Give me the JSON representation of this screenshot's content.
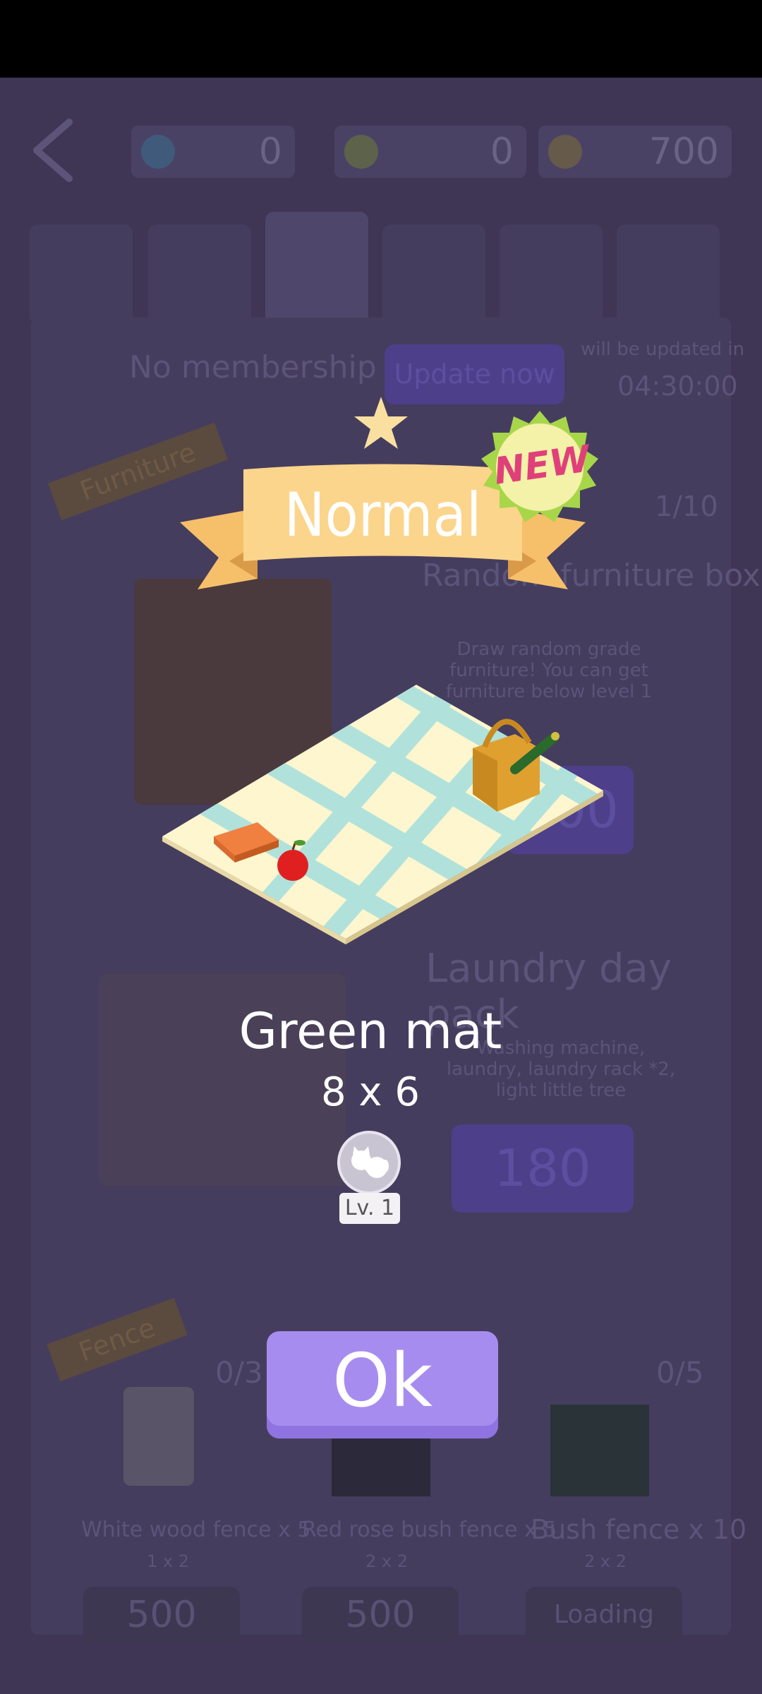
{
  "header": {
    "currency1_value": "0",
    "currency2_value": "0",
    "currency3_value": "700"
  },
  "background_shop": {
    "membership_text": "No membership",
    "update_button": "Update now",
    "update_info": "will be updated in",
    "timer": "04:30:00",
    "furniture_ribbon": "Furniture",
    "random_box_count": "1/10",
    "random_box_title": "Random furniture box",
    "random_box_desc": "Draw random grade furniture! You can get furniture below level 1",
    "random_box_price": "300",
    "laundry_title": "Laundry day pack",
    "laundry_desc": "Washing machine, laundry, laundry rack *2, light little tree",
    "laundry_price": "180",
    "fence_ribbon": "Fence",
    "fence_count_left": "0/3",
    "fence_count_right": "0/5",
    "fence1_name": "White wood fence x 5",
    "fence1_size": "1 x 2",
    "fence2_name": "Red rose bush fence x 5",
    "fence2_size": "2 x 2",
    "fence3_name": "Bush fence x 10",
    "fence3_size": "2 x 2",
    "fence1_price": "500",
    "fence2_price": "500",
    "fence3_button": "Loading"
  },
  "popup": {
    "grade": "Normal",
    "new_badge": "NEW",
    "item_name": "Green mat",
    "item_size": "8 x 6",
    "level": "Lv. 1",
    "ok_button": "Ok"
  },
  "colors": {
    "ok_button": "#a78cf0",
    "banner": "#fbd58c",
    "star": "#f9e0a0",
    "new_badge": "#f3f0a0",
    "new_text": "#e0407a"
  }
}
